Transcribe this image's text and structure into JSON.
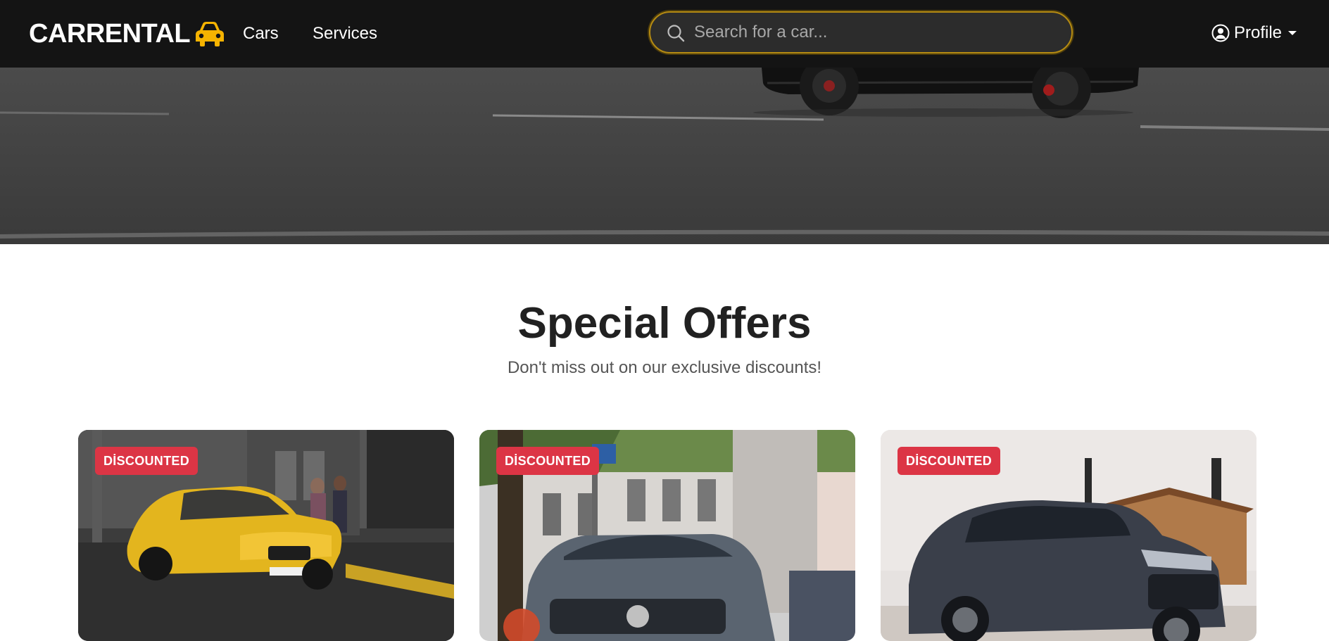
{
  "navbar": {
    "brand": "CARRENTAL",
    "links": [
      {
        "label": "Cars"
      },
      {
        "label": "Services"
      }
    ],
    "search": {
      "placeholder": "Search for a car..."
    },
    "profile_label": "Profile",
    "accent_color": "#f5b301"
  },
  "offers": {
    "title": "Special Offers",
    "subtitle": "Don't miss out on our exclusive discounts!",
    "cards": [
      {
        "badge": "DİSCOUNTED"
      },
      {
        "badge": "DİSCOUNTED"
      },
      {
        "badge": "DİSCOUNTED"
      }
    ],
    "badge_color": "#dc3545"
  }
}
